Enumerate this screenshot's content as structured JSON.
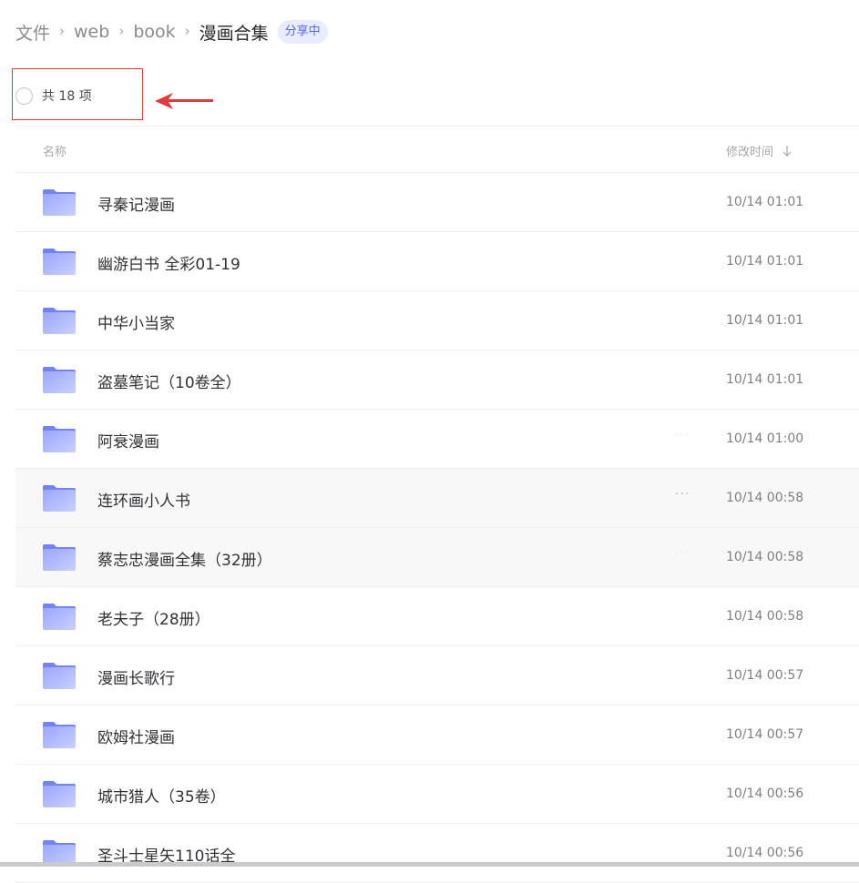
{
  "breadcrumb": {
    "items": [
      "文件",
      "web",
      "book"
    ],
    "current": "漫画合集",
    "separator": "›",
    "share_badge": "分享中"
  },
  "summary": {
    "count_text": "共 18 项"
  },
  "columns": {
    "name": "名称",
    "modified": "修改时间"
  },
  "colors": {
    "accent": "#5a6ae6",
    "annotation_red": "#e13c3c",
    "folder_top": "#9aa6ff",
    "folder_bottom": "#7382f5"
  },
  "icons": {
    "folder": "folder-icon",
    "sort": "arrow-down-icon",
    "more": "more-horizontal-icon",
    "select": "radio-circle-icon"
  },
  "rows": [
    {
      "name": "寻秦记漫画",
      "time": "10/14 01:01",
      "more": "none"
    },
    {
      "name": "幽游白书 全彩01-19",
      "time": "10/14 01:01",
      "more": "none"
    },
    {
      "name": "中华小当家",
      "time": "10/14 01:01",
      "more": "none"
    },
    {
      "name": "盗墓笔记（10卷全）",
      "time": "10/14 01:01",
      "more": "none"
    },
    {
      "name": "阿衰漫画",
      "time": "10/14 01:00",
      "more": "faint"
    },
    {
      "name": "连环画小人书",
      "time": "10/14 00:58",
      "more": "shown",
      "hover": true
    },
    {
      "name": "蔡志忠漫画全集（32册）",
      "time": "10/14 00:58",
      "more": "faint",
      "hover": true
    },
    {
      "name": "老夫子（28册）",
      "time": "10/14 00:58",
      "more": "none"
    },
    {
      "name": "漫画长歌行",
      "time": "10/14 00:57",
      "more": "none"
    },
    {
      "name": "欧姆社漫画",
      "time": "10/14 00:57",
      "more": "none"
    },
    {
      "name": "城市猎人（35卷）",
      "time": "10/14 00:56",
      "more": "none"
    },
    {
      "name": "圣斗士星矢110话全",
      "time": "10/14 00:56",
      "more": "none"
    }
  ],
  "more_glyph": "···"
}
